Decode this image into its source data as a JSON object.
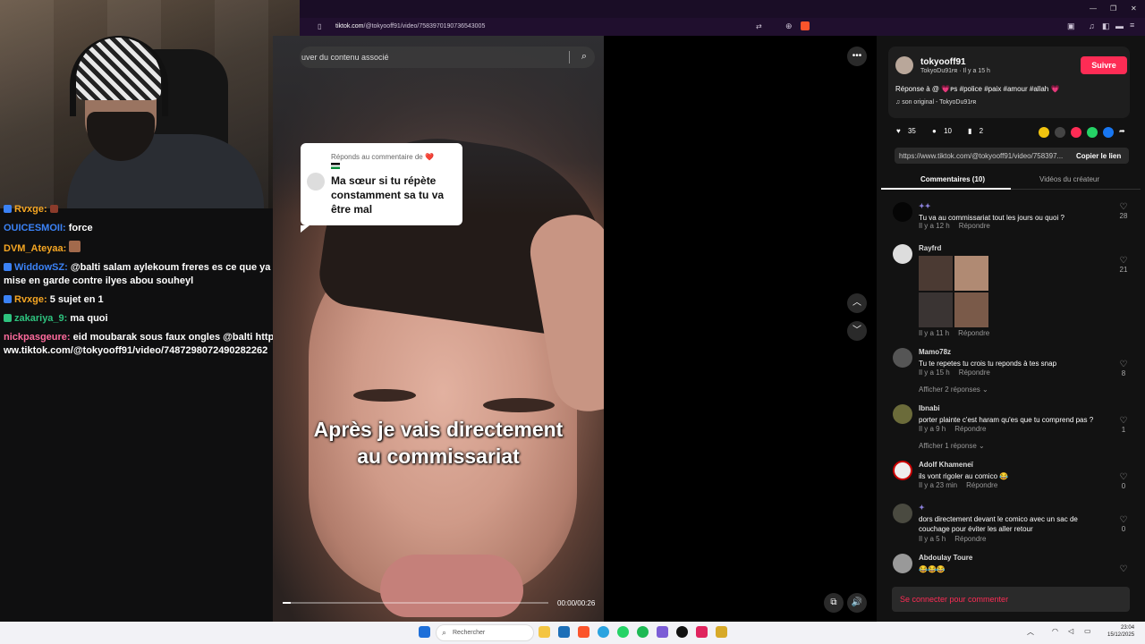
{
  "browser": {
    "url_domain": "tiktok.com",
    "url_path": "/@tokyooff91/video/7583970190736543005"
  },
  "search": {
    "placeholder": "uver du contenu associé"
  },
  "chat": {
    "messages": [
      {
        "user": "Rvxge:",
        "text": "",
        "color": "#f5a623"
      },
      {
        "user": "OUICESMOII:",
        "text": "force",
        "color": "#3b82f6"
      },
      {
        "user": "DVM_Ateyaa:",
        "text": "",
        "color": "#f5a623"
      },
      {
        "user": "WiddowSZ:",
        "text": "@balti salam aylekoum freres es ce que ya une mise en garde contre ilyes abou souheyl",
        "color": "#3b82f6"
      },
      {
        "user": "Rvxge:",
        "text": "5 sujet en 1",
        "color": "#f5a623"
      },
      {
        "user": "zakariya_9:",
        "text": "ma quoi",
        "color": "#2ec27e"
      },
      {
        "user": "nickpasgeure:",
        "text": "eid moubarak sous faux ongles @balti https://www.tiktok.com/@tokyooff91/video/7487298072490282262",
        "color": "#ff6b9d"
      }
    ]
  },
  "video": {
    "reply_header": "Réponds au commentaire de",
    "reply_heart": "❤️",
    "reply_text": "Ma sœur si tu répète constamment sa tu va être mal",
    "caption_line1": "Après je vais directement",
    "caption_line2": "au commissariat",
    "progress": 0.03,
    "timecode": "00:00/00:26"
  },
  "post": {
    "username": "tokyooff91",
    "handle_line": "TokyoDu91ғʀ · Il y a 15 h",
    "follow_label": "Suivre",
    "description": "Réponse à @ 💗ᴘs #police #paix #amour #allah 💗",
    "sound": "son original - TokyoDu91ғʀ",
    "likes": "35",
    "comments": "10",
    "saves": "2",
    "link": "https://www.tiktok.com/@tokyooff91/video/758397...",
    "copy_label": "Copier le lien",
    "tab_comments": "Commentaires (10)",
    "tab_videos": "Vidéos du créateur"
  },
  "comments": [
    {
      "name": "",
      "text": "Tu va au commissariat tout les jours ou quoi ?",
      "time": "Il y a 12 h",
      "reply": "Répondre",
      "likes": "28"
    },
    {
      "name": "Rayfrd",
      "text": "",
      "time": "Il y a 11 h",
      "reply": "Répondre",
      "likes": "21"
    },
    {
      "name": "Mamo78z",
      "text": "Tu te repetes tu crois tu reponds à tes snap",
      "time": "Il y a 15 h",
      "reply": "Répondre",
      "likes": "8",
      "more": "Afficher 2 réponses ⌄"
    },
    {
      "name": "Ibnabi",
      "text": "porter plainte c'est haram qu'es que tu comprend pas ?",
      "time": "Il y a 9 h",
      "reply": "Répondre",
      "likes": "1",
      "more": "Afficher 1 réponse ⌄"
    },
    {
      "name": "Adolf Khameneï",
      "text": "ils vont rigoler au comico 😂",
      "time": "Il y a 23 min",
      "reply": "Répondre",
      "likes": "0"
    },
    {
      "name": "",
      "text": "dors directement devant le comico avec un sac de couchage pour éviter les aller retour",
      "time": "Il y a 5 h",
      "reply": "Répondre",
      "likes": "0"
    },
    {
      "name": "Abdoulay Toure",
      "text": "😂😂😂",
      "time": "",
      "reply": "",
      "likes": ""
    }
  ],
  "login": {
    "label": "Se connecter pour commenter"
  },
  "taskbar": {
    "search_placeholder": "Rechercher",
    "time": "23:04",
    "date": "15/12/2025"
  },
  "colors": {
    "accent": "#fe2c55",
    "browser_bg": "#1a0d26"
  }
}
